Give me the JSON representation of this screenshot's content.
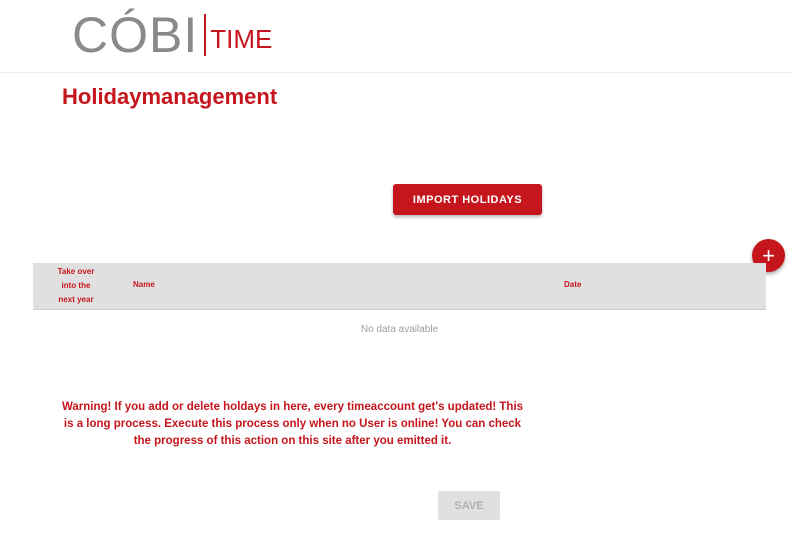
{
  "header": {
    "logo_main": "CÓBI",
    "logo_sub": "TIME"
  },
  "page": {
    "title": "Holidaymanagement"
  },
  "actions": {
    "import_label": "IMPORT HOLIDAYS",
    "add_label": "+",
    "save_label": "SAVE"
  },
  "table": {
    "columns": {
      "takeover_line1": "Take over",
      "takeover_line2": "into the",
      "takeover_line3": "next year",
      "name": "Name",
      "date": "Date"
    },
    "empty_text": "No data available"
  },
  "warning": {
    "line1": "Warning! If you add or delete holdays in here, every timeaccount get's updated! This",
    "line2": "is a long process. Execute this process only when no User is online! You can check",
    "line3": "the progress of this action on this site after you emitted it."
  },
  "colors": {
    "brand": "#c5161d",
    "logo_gray": "#8a8a8a",
    "table_header": "#e0e0e0"
  }
}
